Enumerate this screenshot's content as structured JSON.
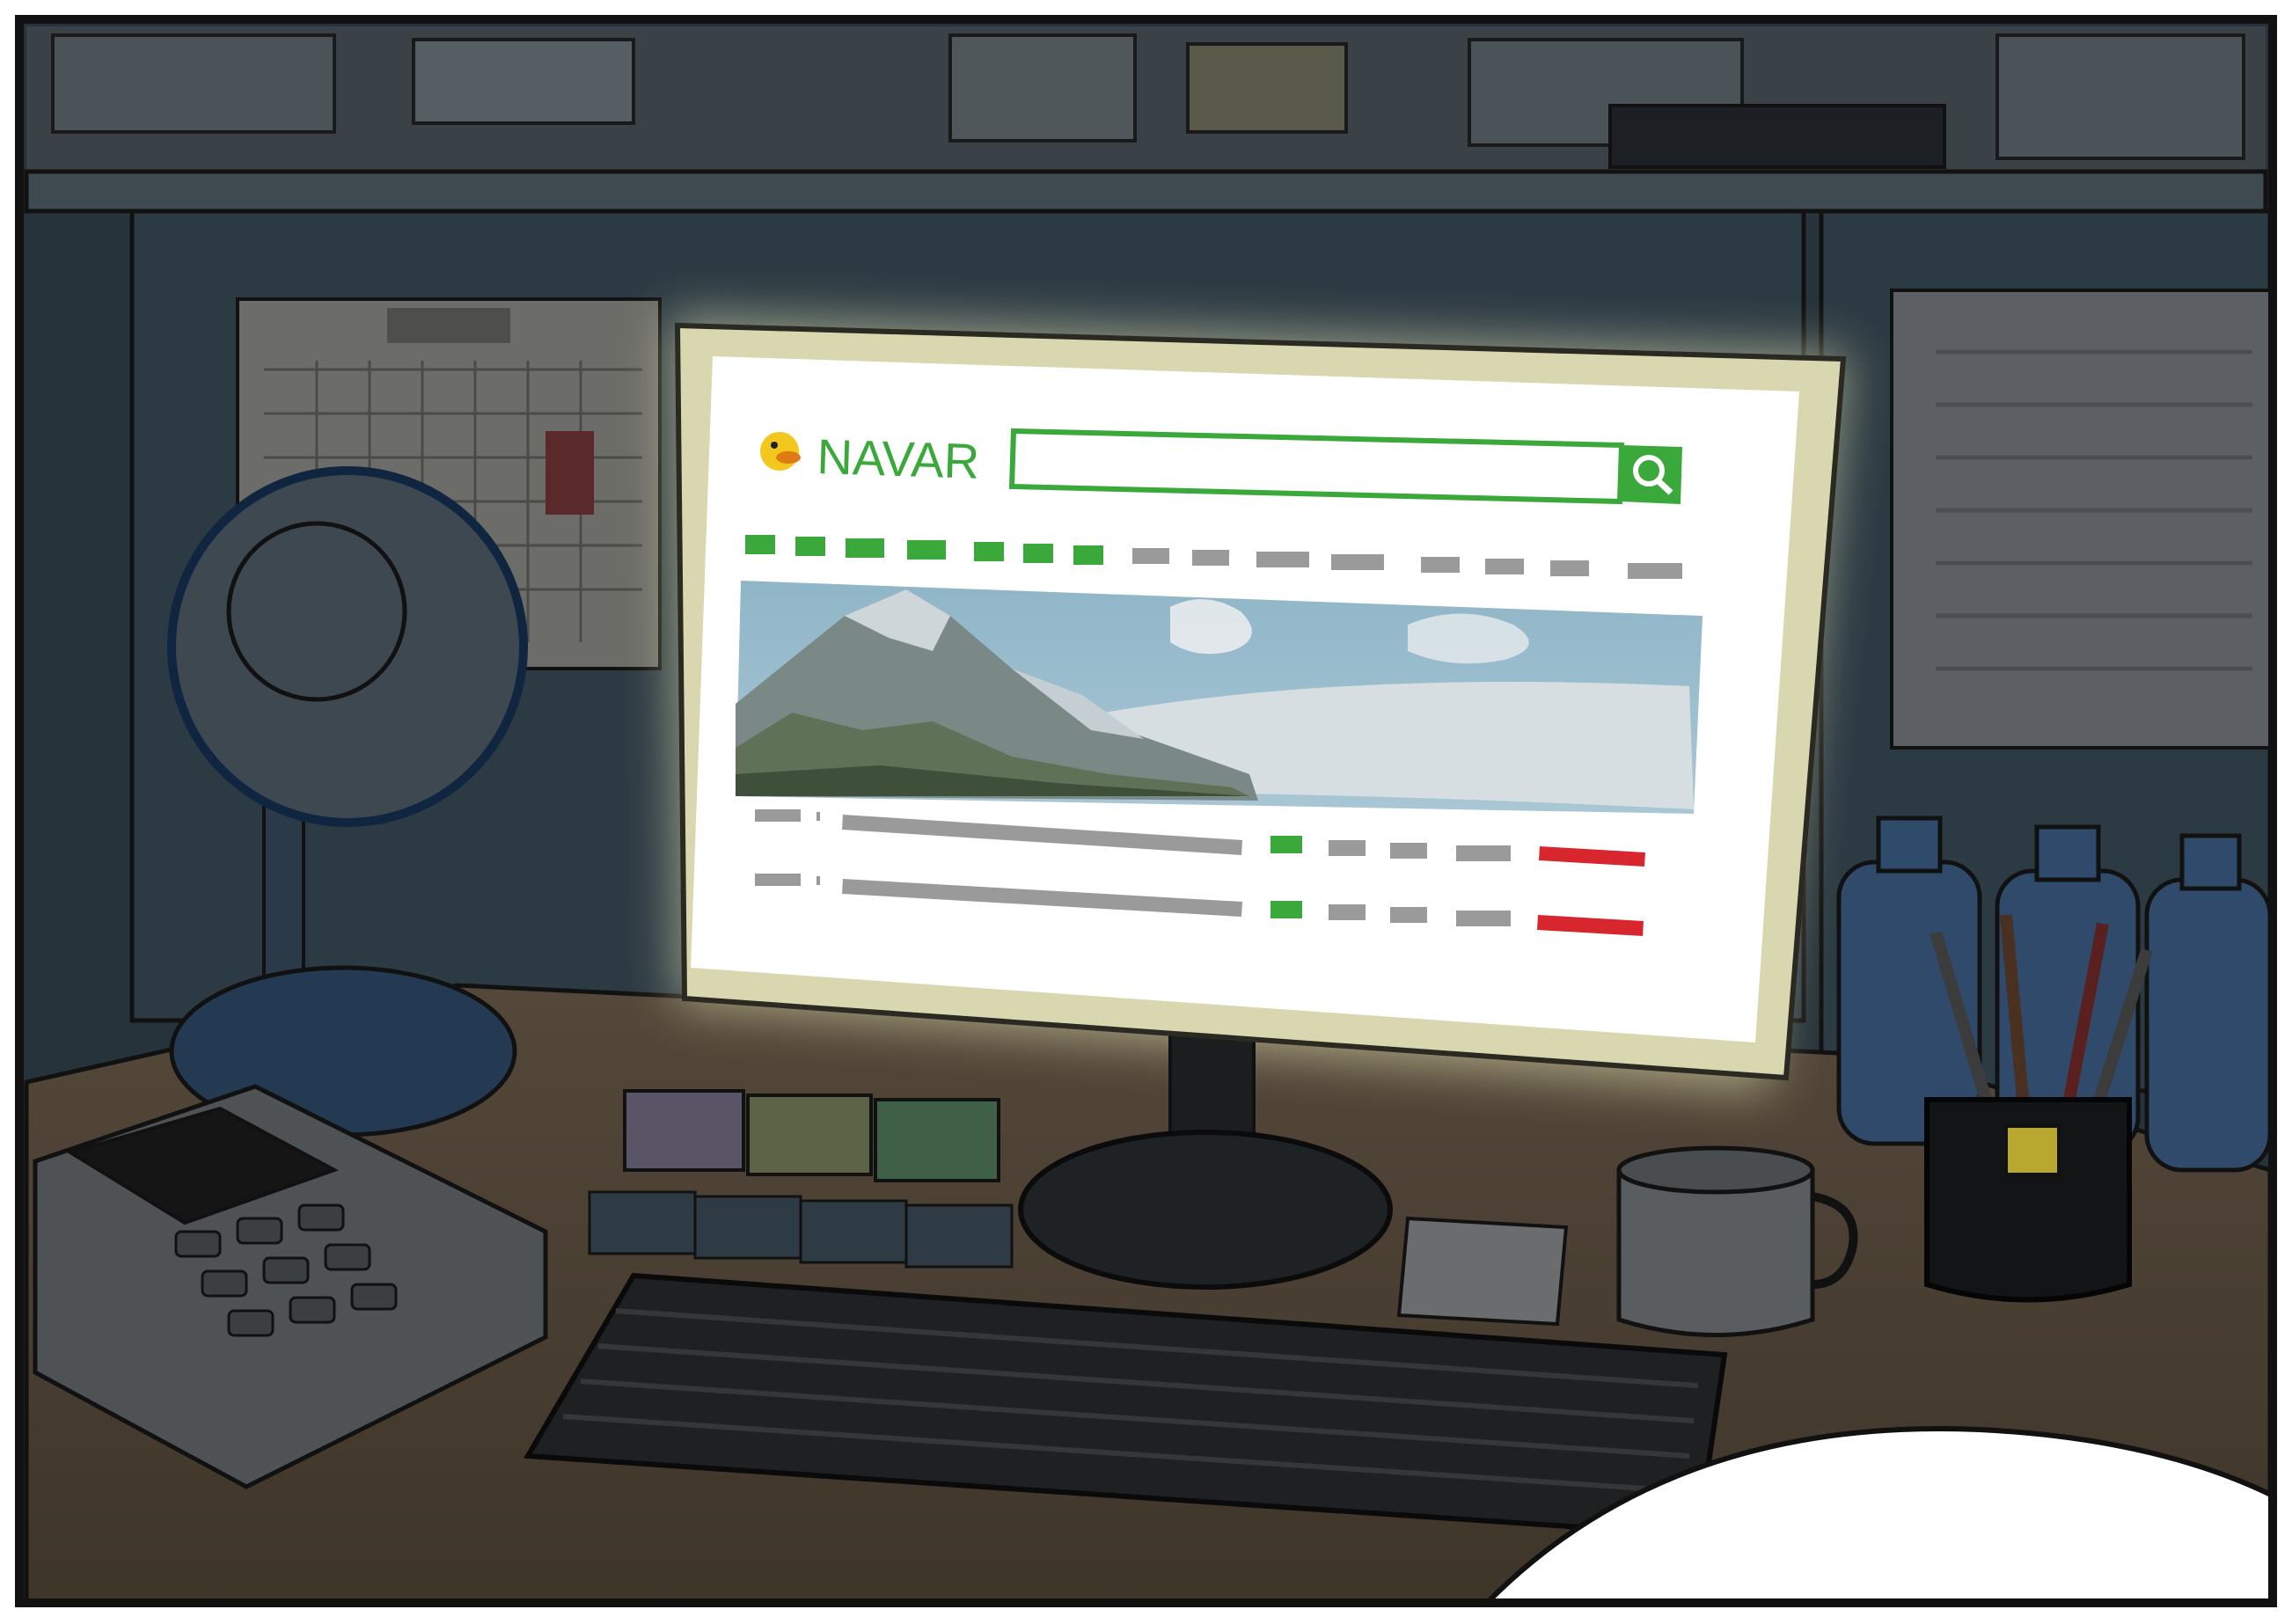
{
  "screen": {
    "logo_text": "NAVAR",
    "search": {
      "value": "",
      "placeholder": ""
    },
    "colors": {
      "brand_green": "#3aa83a",
      "nav_gray": "#9a9a9a",
      "alert_red": "#d8262e",
      "screen_bg": "#ffffff",
      "glow": "#f4f2c0"
    },
    "icons": {
      "logo": "duck-logo-icon",
      "search": "magnifier-icon"
    }
  }
}
